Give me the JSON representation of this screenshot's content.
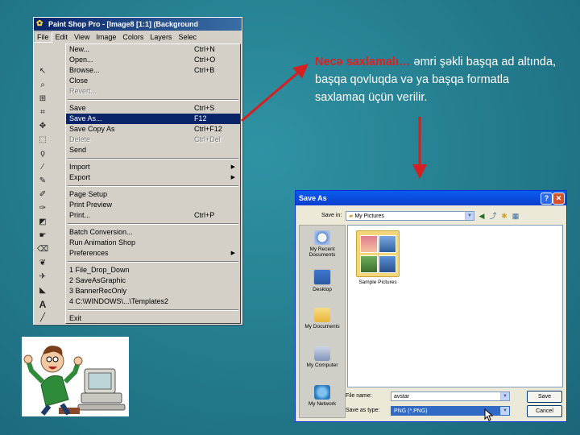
{
  "psp": {
    "title": "Paint Shop Pro - [Image8 [1:1] (Background",
    "menubar": [
      "File",
      "Edit",
      "View",
      "Image",
      "Colors",
      "Layers",
      "Selec"
    ],
    "menu_items": [
      {
        "label": "New...",
        "shortcut": "Ctrl+N",
        "disabled": false
      },
      {
        "label": "Open...",
        "shortcut": "Ctrl+O",
        "disabled": false
      },
      {
        "label": "Browse...",
        "shortcut": "Ctrl+B",
        "disabled": false
      },
      {
        "label": "Close",
        "shortcut": "",
        "disabled": false
      },
      {
        "label": "Revert...",
        "shortcut": "",
        "disabled": true
      },
      {
        "sep": true
      },
      {
        "label": "Save",
        "shortcut": "Ctrl+S",
        "disabled": false
      },
      {
        "label": "Save As...",
        "shortcut": "F12",
        "disabled": false,
        "highlight": true
      },
      {
        "label": "Save Copy As",
        "shortcut": "Ctrl+F12",
        "disabled": false
      },
      {
        "label": "Delete",
        "shortcut": "Ctrl+Del",
        "disabled": true
      },
      {
        "label": "Send",
        "shortcut": "",
        "disabled": false
      },
      {
        "sep": true
      },
      {
        "label": "Import",
        "shortcut": "",
        "submenu": true
      },
      {
        "label": "Export",
        "shortcut": "",
        "submenu": true
      },
      {
        "sep": true
      },
      {
        "label": "Page Setup",
        "shortcut": ""
      },
      {
        "label": "Print Preview",
        "shortcut": ""
      },
      {
        "label": "Print...",
        "shortcut": "Ctrl+P"
      },
      {
        "sep": true
      },
      {
        "label": "Batch Conversion...",
        "shortcut": ""
      },
      {
        "label": "Run Animation Shop",
        "shortcut": ""
      },
      {
        "label": "Preferences",
        "shortcut": "",
        "submenu": true
      },
      {
        "sep": true
      },
      {
        "label": "1 File_Drop_Down",
        "shortcut": ""
      },
      {
        "label": "2 SaveAsGraphic",
        "shortcut": ""
      },
      {
        "label": "3 BannerRecOnly",
        "shortcut": ""
      },
      {
        "label": "4 C:\\WINDOWS\\...\\Templates2",
        "shortcut": ""
      },
      {
        "sep": true
      },
      {
        "label": "Exit",
        "shortcut": ""
      }
    ]
  },
  "caption": {
    "highlight": "Necə saxlamalı…",
    "body": " əmri şəkli başqa ad altında, başqa qovluqda və ya başqa formatla saxlamaq üçün verilir."
  },
  "save_dialog": {
    "title": "Save As",
    "save_in_label": "Save in:",
    "save_in_value": "My Pictures",
    "places": [
      "My Recent Documents",
      "Desktop",
      "My Documents",
      "My Computer",
      "My Network"
    ],
    "folder_name": "Sample Pictures",
    "file_name_label": "File name:",
    "file_name_value": "avstar",
    "save_as_type_label": "Save as type:",
    "save_as_type_value": "PNG (*.PNG)",
    "save_button": "Save",
    "cancel_button": "Cancel"
  },
  "colors": {
    "menu_highlight": "#0a246a",
    "caption_highlight": "#e02020",
    "arrow": "#d42020"
  }
}
